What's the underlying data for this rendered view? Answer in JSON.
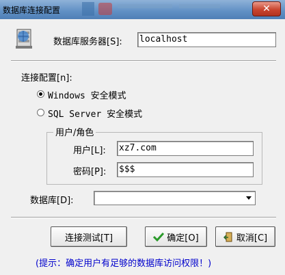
{
  "window": {
    "title": "数据库连接配置",
    "close_label": "✕"
  },
  "server": {
    "label": "数据库服务器[S]:",
    "value": "localhost"
  },
  "connection": {
    "label": "连接配置[n]:",
    "options": [
      {
        "label": "Windows 安全模式",
        "selected": true
      },
      {
        "label": "SQL Server 安全模式",
        "selected": false
      }
    ]
  },
  "user_role": {
    "group_label": "用户/角色",
    "user_label": "用户[L]:",
    "user_value": "xz7.com",
    "password_label": "密码[P]:",
    "password_value": "$$$"
  },
  "database": {
    "label": "数据库[D]:",
    "value": ""
  },
  "buttons": {
    "test": "连接测试[T]",
    "ok": "确定[O]",
    "cancel": "取消[C]"
  },
  "hint": "(提示：确定用户有足够的数据库访问权限！)",
  "colors": {
    "title_bar": "#5f8fc4",
    "hint_text": "#0000cc",
    "ok_check": "#2a9a2a"
  },
  "icons": [
    "database-server-icon",
    "check-icon",
    "exit-door-icon",
    "chevron-down-icon"
  ]
}
